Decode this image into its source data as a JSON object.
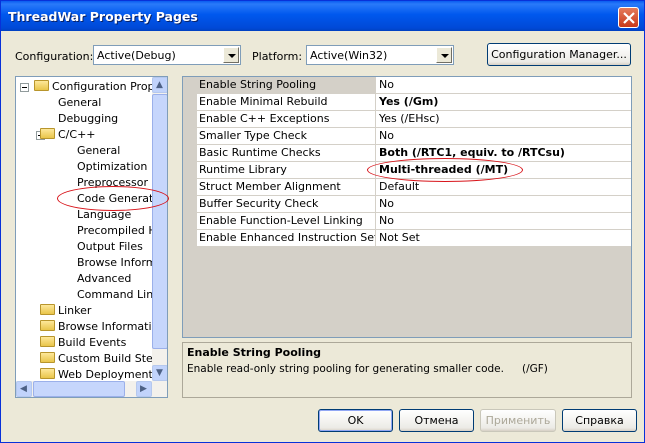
{
  "window": {
    "title": "ThreadWar Property Pages"
  },
  "toolbar": {
    "configuration_label": "Configuration:",
    "configuration_value": "Active(Debug)",
    "platform_label": "Platform:",
    "platform_value": "Active(Win32)",
    "config_manager_label": "Configuration Manager..."
  },
  "tree": {
    "items": [
      {
        "label": "Configuration Propertie"
      },
      {
        "label": "General"
      },
      {
        "label": "Debugging"
      },
      {
        "label": "C/C++"
      },
      {
        "label": "General"
      },
      {
        "label": "Optimization"
      },
      {
        "label": "Preprocessor"
      },
      {
        "label": "Code Generatio"
      },
      {
        "label": "Language"
      },
      {
        "label": "Precompiled He"
      },
      {
        "label": "Output Files"
      },
      {
        "label": "Browse Informa"
      },
      {
        "label": "Advanced"
      },
      {
        "label": "Command Line"
      },
      {
        "label": "Linker"
      },
      {
        "label": "Browse Information"
      },
      {
        "label": "Build Events"
      },
      {
        "label": "Custom Build Step"
      },
      {
        "label": "Web Deployment"
      }
    ]
  },
  "grid": {
    "rows": [
      {
        "name": "Enable String Pooling",
        "value": "No"
      },
      {
        "name": "Enable Minimal Rebuild",
        "value": "Yes (/Gm)"
      },
      {
        "name": "Enable C++ Exceptions",
        "value": "Yes (/EHsc)"
      },
      {
        "name": "Smaller Type Check",
        "value": "No"
      },
      {
        "name": "Basic Runtime Checks",
        "value": "Both (/RTC1, equiv. to /RTCsu)"
      },
      {
        "name": "Runtime Library",
        "value": "Multi-threaded (/MT)"
      },
      {
        "name": "Struct Member Alignment",
        "value": "Default"
      },
      {
        "name": "Buffer Security Check",
        "value": "No"
      },
      {
        "name": "Enable Function-Level Linking",
        "value": "No"
      },
      {
        "name": "Enable Enhanced Instruction Set",
        "value": "Not Set"
      }
    ]
  },
  "description": {
    "title": "Enable String Pooling",
    "text": "Enable read-only string pooling for generating smaller code.",
    "switch": "(/GF)"
  },
  "buttons": {
    "ok": "OK",
    "cancel": "Отмена",
    "apply": "Применить",
    "help": "Справка"
  },
  "colors": {
    "title_bar": "#0058ee",
    "annotation_ring": "#d8141a"
  }
}
